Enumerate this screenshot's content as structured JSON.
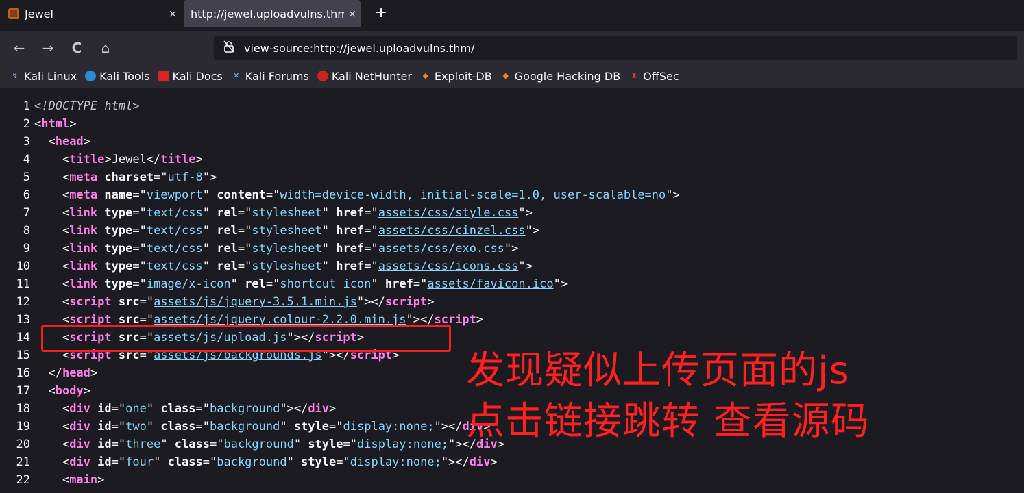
{
  "tabs": [
    {
      "title": "Jewel",
      "close": "×"
    },
    {
      "title": "http://jewel.uploadvulns.thm/",
      "close": "×"
    }
  ],
  "new_tab": "+",
  "nav": {
    "back": "←",
    "forward": "→",
    "reload": "C",
    "home": "⌂"
  },
  "url": "view-source:http://jewel.uploadvulns.thm/",
  "bookmarks": [
    "Kali Linux",
    "Kali Tools",
    "Kali Docs",
    "Kali Forums",
    "Kali NetHunter",
    "Exploit-DB",
    "Google Hacking DB",
    "OffSec"
  ],
  "source_lines": [
    {
      "n": "1",
      "segs": [
        {
          "t": "<!DOCTYPE html>",
          "c": "doc"
        }
      ]
    },
    {
      "n": "2",
      "segs": [
        {
          "t": "<"
        },
        {
          "t": "html",
          "c": "tag"
        },
        {
          "t": ">"
        }
      ]
    },
    {
      "n": "3",
      "segs": [
        {
          "t": "  <"
        },
        {
          "t": "head",
          "c": "tag"
        },
        {
          "t": ">"
        }
      ]
    },
    {
      "n": "4",
      "segs": [
        {
          "t": "    <"
        },
        {
          "t": "title",
          "c": "tag"
        },
        {
          "t": ">Jewel</"
        },
        {
          "t": "title",
          "c": "tag"
        },
        {
          "t": ">"
        }
      ]
    },
    {
      "n": "5",
      "segs": [
        {
          "t": "    <"
        },
        {
          "t": "meta",
          "c": "tag"
        },
        {
          "t": " "
        },
        {
          "t": "charset",
          "c": "attr"
        },
        {
          "t": "=\""
        },
        {
          "t": "utf-8",
          "c": "val"
        },
        {
          "t": "\">"
        }
      ]
    },
    {
      "n": "6",
      "segs": [
        {
          "t": "    <"
        },
        {
          "t": "meta",
          "c": "tag"
        },
        {
          "t": " "
        },
        {
          "t": "name",
          "c": "attr"
        },
        {
          "t": "=\""
        },
        {
          "t": "viewport",
          "c": "val"
        },
        {
          "t": "\" "
        },
        {
          "t": "content",
          "c": "attr"
        },
        {
          "t": "=\""
        },
        {
          "t": "width=device-width, initial-scale=1.0, user-scalable=no",
          "c": "val"
        },
        {
          "t": "\">"
        }
      ]
    },
    {
      "n": "7",
      "segs": [
        {
          "t": "    <"
        },
        {
          "t": "link",
          "c": "tag"
        },
        {
          "t": " "
        },
        {
          "t": "type",
          "c": "attr"
        },
        {
          "t": "=\""
        },
        {
          "t": "text/css",
          "c": "val"
        },
        {
          "t": "\" "
        },
        {
          "t": "rel",
          "c": "attr"
        },
        {
          "t": "=\""
        },
        {
          "t": "stylesheet",
          "c": "val"
        },
        {
          "t": "\" "
        },
        {
          "t": "href",
          "c": "attr"
        },
        {
          "t": "=\""
        },
        {
          "t": "assets/css/style.css",
          "c": "link"
        },
        {
          "t": "\">"
        }
      ]
    },
    {
      "n": "8",
      "segs": [
        {
          "t": "    <"
        },
        {
          "t": "link",
          "c": "tag"
        },
        {
          "t": " "
        },
        {
          "t": "type",
          "c": "attr"
        },
        {
          "t": "=\""
        },
        {
          "t": "text/css",
          "c": "val"
        },
        {
          "t": "\" "
        },
        {
          "t": "rel",
          "c": "attr"
        },
        {
          "t": "=\""
        },
        {
          "t": "stylesheet",
          "c": "val"
        },
        {
          "t": "\" "
        },
        {
          "t": "href",
          "c": "attr"
        },
        {
          "t": "=\""
        },
        {
          "t": "assets/css/cinzel.css",
          "c": "link"
        },
        {
          "t": "\">"
        }
      ]
    },
    {
      "n": "9",
      "segs": [
        {
          "t": "    <"
        },
        {
          "t": "link",
          "c": "tag"
        },
        {
          "t": " "
        },
        {
          "t": "type",
          "c": "attr"
        },
        {
          "t": "=\""
        },
        {
          "t": "text/css",
          "c": "val"
        },
        {
          "t": "\" "
        },
        {
          "t": "rel",
          "c": "attr"
        },
        {
          "t": "=\""
        },
        {
          "t": "stylesheet",
          "c": "val"
        },
        {
          "t": "\" "
        },
        {
          "t": "href",
          "c": "attr"
        },
        {
          "t": "=\""
        },
        {
          "t": "assets/css/exo.css",
          "c": "link"
        },
        {
          "t": "\">"
        }
      ]
    },
    {
      "n": "10",
      "segs": [
        {
          "t": "    <"
        },
        {
          "t": "link",
          "c": "tag"
        },
        {
          "t": " "
        },
        {
          "t": "type",
          "c": "attr"
        },
        {
          "t": "=\""
        },
        {
          "t": "text/css",
          "c": "val"
        },
        {
          "t": "\" "
        },
        {
          "t": "rel",
          "c": "attr"
        },
        {
          "t": "=\""
        },
        {
          "t": "stylesheet",
          "c": "val"
        },
        {
          "t": "\" "
        },
        {
          "t": "href",
          "c": "attr"
        },
        {
          "t": "=\""
        },
        {
          "t": "assets/css/icons.css",
          "c": "link"
        },
        {
          "t": "\">"
        }
      ]
    },
    {
      "n": "11",
      "segs": [
        {
          "t": "    <"
        },
        {
          "t": "link",
          "c": "tag"
        },
        {
          "t": " "
        },
        {
          "t": "type",
          "c": "attr"
        },
        {
          "t": "=\""
        },
        {
          "t": "image/x-icon",
          "c": "val"
        },
        {
          "t": "\" "
        },
        {
          "t": "rel",
          "c": "attr"
        },
        {
          "t": "=\""
        },
        {
          "t": "shortcut icon",
          "c": "val"
        },
        {
          "t": "\" "
        },
        {
          "t": "href",
          "c": "attr"
        },
        {
          "t": "=\""
        },
        {
          "t": "assets/favicon.ico",
          "c": "link"
        },
        {
          "t": "\">"
        }
      ]
    },
    {
      "n": "12",
      "segs": [
        {
          "t": "    <"
        },
        {
          "t": "script",
          "c": "tag"
        },
        {
          "t": " "
        },
        {
          "t": "src",
          "c": "attr"
        },
        {
          "t": "=\""
        },
        {
          "t": "assets/js/jquery-3.5.1.min.js",
          "c": "link"
        },
        {
          "t": "\"></"
        },
        {
          "t": "script",
          "c": "tag"
        },
        {
          "t": ">"
        }
      ]
    },
    {
      "n": "13",
      "segs": [
        {
          "t": "    <"
        },
        {
          "t": "script",
          "c": "tag"
        },
        {
          "t": " "
        },
        {
          "t": "src",
          "c": "attr"
        },
        {
          "t": "=\""
        },
        {
          "t": "assets/js/jquery.colour-2.2.0.min.js",
          "c": "link"
        },
        {
          "t": "\"></"
        },
        {
          "t": "script",
          "c": "tag"
        },
        {
          "t": ">"
        }
      ]
    },
    {
      "n": "14",
      "segs": [
        {
          "t": "    <"
        },
        {
          "t": "script",
          "c": "tag"
        },
        {
          "t": " "
        },
        {
          "t": "src",
          "c": "attr"
        },
        {
          "t": "=\""
        },
        {
          "t": "assets/js/upload.js",
          "c": "link"
        },
        {
          "t": "\"></"
        },
        {
          "t": "script",
          "c": "tag"
        },
        {
          "t": ">"
        }
      ]
    },
    {
      "n": "15",
      "segs": [
        {
          "t": "    <"
        },
        {
          "t": "script",
          "c": "tag"
        },
        {
          "t": " "
        },
        {
          "t": "src",
          "c": "attr"
        },
        {
          "t": "=\""
        },
        {
          "t": "assets/js/backgrounds.js",
          "c": "link"
        },
        {
          "t": "\"></"
        },
        {
          "t": "script",
          "c": "tag"
        },
        {
          "t": ">"
        }
      ]
    },
    {
      "n": "16",
      "segs": [
        {
          "t": "  </"
        },
        {
          "t": "head",
          "c": "tag"
        },
        {
          "t": ">"
        }
      ]
    },
    {
      "n": "17",
      "segs": [
        {
          "t": "  <"
        },
        {
          "t": "body",
          "c": "tag"
        },
        {
          "t": ">"
        }
      ]
    },
    {
      "n": "18",
      "segs": [
        {
          "t": "    <"
        },
        {
          "t": "div",
          "c": "tag"
        },
        {
          "t": " "
        },
        {
          "t": "id",
          "c": "attr"
        },
        {
          "t": "=\""
        },
        {
          "t": "one",
          "c": "val"
        },
        {
          "t": "\" "
        },
        {
          "t": "class",
          "c": "attr"
        },
        {
          "t": "=\""
        },
        {
          "t": "background",
          "c": "val"
        },
        {
          "t": "\"></"
        },
        {
          "t": "div",
          "c": "tag"
        },
        {
          "t": ">"
        }
      ]
    },
    {
      "n": "19",
      "segs": [
        {
          "t": "    <"
        },
        {
          "t": "div",
          "c": "tag"
        },
        {
          "t": " "
        },
        {
          "t": "id",
          "c": "attr"
        },
        {
          "t": "=\""
        },
        {
          "t": "two",
          "c": "val"
        },
        {
          "t": "\" "
        },
        {
          "t": "class",
          "c": "attr"
        },
        {
          "t": "=\""
        },
        {
          "t": "background",
          "c": "val"
        },
        {
          "t": "\" "
        },
        {
          "t": "style",
          "c": "attr"
        },
        {
          "t": "=\""
        },
        {
          "t": "display:none;",
          "c": "val"
        },
        {
          "t": "\"></"
        },
        {
          "t": "div",
          "c": "tag"
        },
        {
          "t": ">"
        }
      ]
    },
    {
      "n": "20",
      "segs": [
        {
          "t": "    <"
        },
        {
          "t": "div",
          "c": "tag"
        },
        {
          "t": " "
        },
        {
          "t": "id",
          "c": "attr"
        },
        {
          "t": "=\""
        },
        {
          "t": "three",
          "c": "val"
        },
        {
          "t": "\" "
        },
        {
          "t": "class",
          "c": "attr"
        },
        {
          "t": "=\""
        },
        {
          "t": "background",
          "c": "val"
        },
        {
          "t": "\" "
        },
        {
          "t": "style",
          "c": "attr"
        },
        {
          "t": "=\""
        },
        {
          "t": "display:none;",
          "c": "val"
        },
        {
          "t": "\"></"
        },
        {
          "t": "div",
          "c": "tag"
        },
        {
          "t": ">"
        }
      ]
    },
    {
      "n": "21",
      "segs": [
        {
          "t": "    <"
        },
        {
          "t": "div",
          "c": "tag"
        },
        {
          "t": " "
        },
        {
          "t": "id",
          "c": "attr"
        },
        {
          "t": "=\""
        },
        {
          "t": "four",
          "c": "val"
        },
        {
          "t": "\" "
        },
        {
          "t": "class",
          "c": "attr"
        },
        {
          "t": "=\""
        },
        {
          "t": "background",
          "c": "val"
        },
        {
          "t": "\" "
        },
        {
          "t": "style",
          "c": "attr"
        },
        {
          "t": "=\""
        },
        {
          "t": "display:none;",
          "c": "val"
        },
        {
          "t": "\"></"
        },
        {
          "t": "div",
          "c": "tag"
        },
        {
          "t": ">"
        }
      ]
    },
    {
      "n": "22",
      "segs": [
        {
          "t": "    <"
        },
        {
          "t": "main",
          "c": "tag"
        },
        {
          "t": ">"
        }
      ]
    }
  ],
  "annotation": {
    "line1": "发现疑似上传页面的js",
    "line2": "点击链接跳转 查看源码",
    "color": "#ff2020"
  }
}
